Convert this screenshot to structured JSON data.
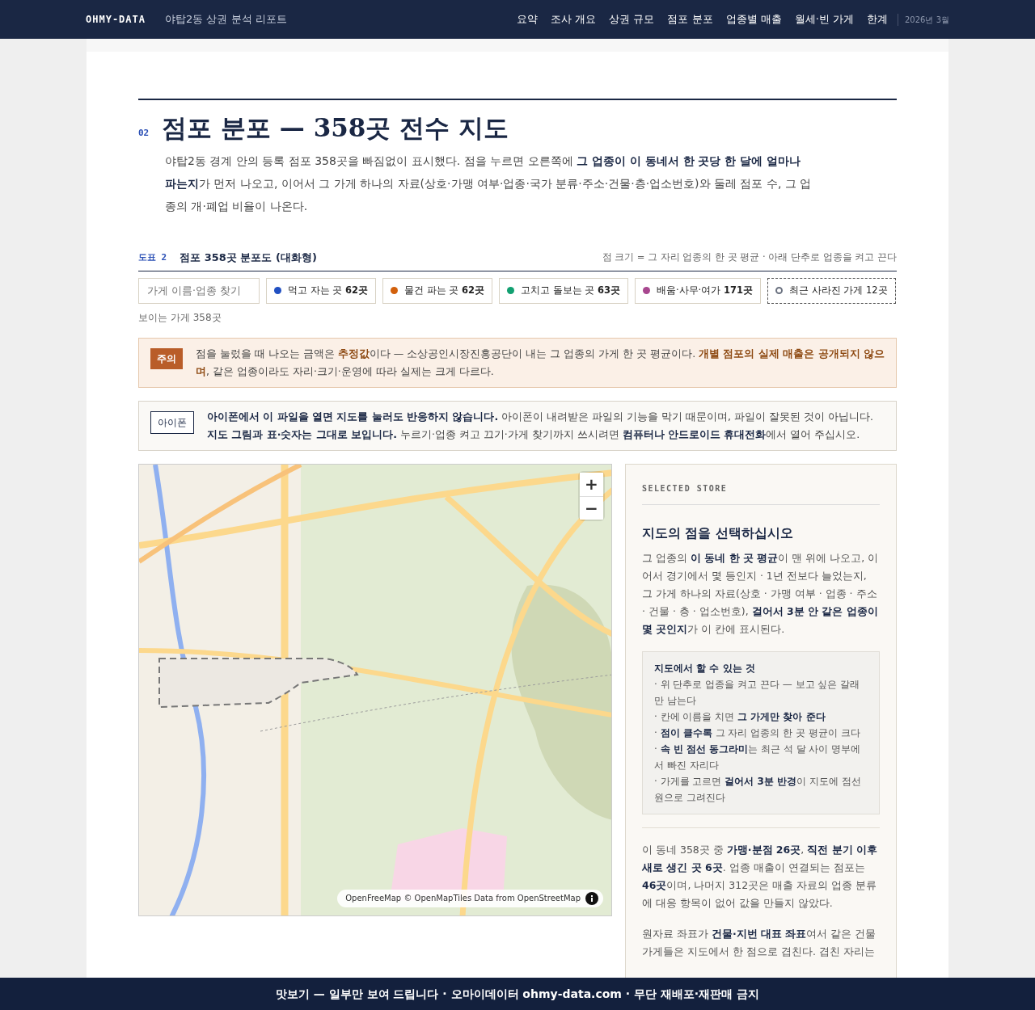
{
  "navbar": {
    "brand": "OHMY-DATA",
    "subtitle": "야탑2동 상권 분석 리포트",
    "links": [
      {
        "label": "요약",
        "selected": false
      },
      {
        "label": "조사 개요",
        "selected": false
      },
      {
        "label": "상권 규모",
        "selected": false
      },
      {
        "label": "점포 분포",
        "selected": false
      },
      {
        "label": "업종별 매출",
        "selected": false
      },
      {
        "label": "월세·빈 가게",
        "selected": false
      },
      {
        "label": "한계",
        "selected": false
      }
    ],
    "date": "2026년 3월"
  },
  "section": {
    "number": "02",
    "title": "점포 분포 — 358곳 전수 지도",
    "intro": "야탑2동 경계 안의 등록 점포 358곳을 빠짐없이 표시했다. 점을 누르면 오른쪽에 **그 업종이 이 동네서 한 곳당 한 달에 얼마나 파는지**가 먼저 나오고, 이어서 그 가게 하나의 자료(상호·가맹 여부·업종·국가 분류·주소·건물·층·업소번호)와 둘레 점포 수, 그 업종의 개·폐업 비율이 나온다."
  },
  "figure": {
    "label": "도표 2",
    "title": "점포 358곳 분포도 (대화형)",
    "note": "점 크기 = 그 자리 업종의 한 곳 평균 · 아래 단추로 업종을 켜고 끈다"
  },
  "search": {
    "placeholder": "가게 이름·업종 찾기"
  },
  "filters": [
    {
      "kind": "category",
      "label": "먹고 자는 곳 **62곳**",
      "color": "#2150c2",
      "on": true
    },
    {
      "kind": "category",
      "label": "물건 파는 곳 **62곳**",
      "color": "#d2600c",
      "on": true
    },
    {
      "kind": "category",
      "label": "고치고 돌보는 곳 **63곳**",
      "color": "#12a071",
      "on": true
    },
    {
      "kind": "category",
      "label": "배움·사무·여가 **171곳**",
      "color": "#a8478f",
      "on": true
    },
    {
      "kind": "closed",
      "label": "최근 사라진 가게 12곳",
      "color": "#6b7280",
      "on": true
    }
  ],
  "visible_count": "보이는 가게 358곳",
  "notices": [
    {
      "kind": "warning",
      "badge": "주의",
      "text": "점을 눌렀을 때 나오는 금액은 **추정값**이다 — 소상공인시장진흥공단이 내는 그 업종의 가게 한 곳 평균이다. **개별 점포의 실제 매출은 공개되지 않으며**, 같은 업종이라도 자리·크기·운영에 따라 실제는 크게 다르다."
    },
    {
      "kind": "info",
      "badge": "아이폰",
      "text": "**아이폰에서 이 파일을 열면 지도를 눌러도 반응하지 않습니다.** 아이폰이 내려받은 파일의 기능을 막기 때문이며, 파일이 잘못된 것이 아닙니다. **지도 그림과 표·숫자는 그대로 보입니다.** 누르기·업종 켜고 끄기·가게 찾기까지 쓰시려면 **컴퓨터나 안드로이드 휴대전화**에서 열어 주십시오."
    }
  ],
  "map": {
    "kind": "picture",
    "zoom_in": "+",
    "zoom_out": "−",
    "attribution": "OpenFreeMap © OpenMapTiles Data from OpenStreetMap"
  },
  "panel": {
    "eyebrow": "SELECTED STORE",
    "title": "지도의 점을 선택하십시오",
    "description": "그 업종의 **이 동네 한 곳 평균**이 맨 위에 나오고, 이어서 경기에서 몇 등인지 · 1년 전보다 늘었는지, 그 가게 하나의 자료(상호 · 가맹 여부 · 업종 · 주소 · 건물 · 층 · 업소번호), **걸어서 3분 안 같은 업종이 몇 곳인지**가 이 칸에 표시된다.",
    "help": {
      "title": "지도에서 할 수 있는 것",
      "items": [
        "· 위 단추로 업종을 켜고 끈다 — 보고 싶은 갈래만 남는다",
        "· 칸에 이름을 치면 **그 가게만 찾아 준다**",
        "· **점이 클수록** 그 자리 업종의 한 곳 평균이 크다",
        "· **속 빈 점선 동그라미**는 최근 석 달 사이 명부에서 빠진 자리다",
        "· 가게를 고르면 **걸어서 3분 반경**이 지도에 점선 원으로 그려진다"
      ]
    },
    "paragraphs": [
      "이 동네 358곳 중 **가맹·분점 26곳**, **직전 분기 이후 새로 생긴 곳 6곳**. 업종 매출이 연결되는 점포는 **46곳**이며, 나머지 312곳은 매출 자료의 업종 분류에 대응 항목이 없어 값을 만들지 않았다.",
      "원자료 좌표가 **건물·지번 대표 좌표**여서 같은 건물 가게들은 지도에서 한 점으로 겹친다. 겹친 자리는"
    ]
  },
  "footer": "맛보기 — 일부만 보여 드립니다 · 오마이데이터 ohmy-data.com · 무단 재배포·재판매 금지"
}
